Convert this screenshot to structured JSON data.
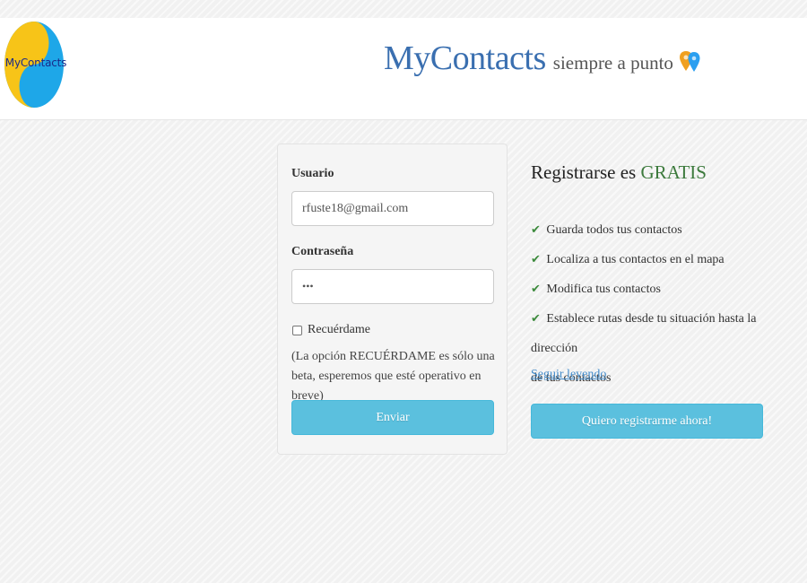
{
  "header": {
    "logo_text": "MyContacts",
    "brand_name": "MyContacts",
    "tagline": "siempre a punto",
    "tagline_icon": "map-pins-icon"
  },
  "login": {
    "username_label": "Usuario",
    "username_value": "rfuste18@gmail.com",
    "password_label": "Contraseña",
    "password_value": "•••",
    "remember_label": "Recuérdame",
    "remember_checked": false,
    "beta_note": "(La opción RECUÉRDAME es sólo una beta, esperemos que esté operativo en breve)",
    "submit_label": "Enviar"
  },
  "register": {
    "title_prefix": "Registrarse es",
    "title_emphasis": "GRATIS",
    "features": [
      "Guarda todos tus contactos",
      "Localiza a tus contactos en el mapa",
      "Modifica tus contactos",
      "Establece rutas desde tu situación hasta la dirección"
    ],
    "feature_continuation": "de tus contactos",
    "check_icon": "✔",
    "read_more": "Seguir leyendo",
    "register_button": "Quiero registrarme ahora!"
  },
  "colors": {
    "accent": "#5bc0de",
    "brand": "#3a6fb0",
    "free": "#3c7a3c",
    "check": "#3c8a3c",
    "link": "#428bca"
  }
}
